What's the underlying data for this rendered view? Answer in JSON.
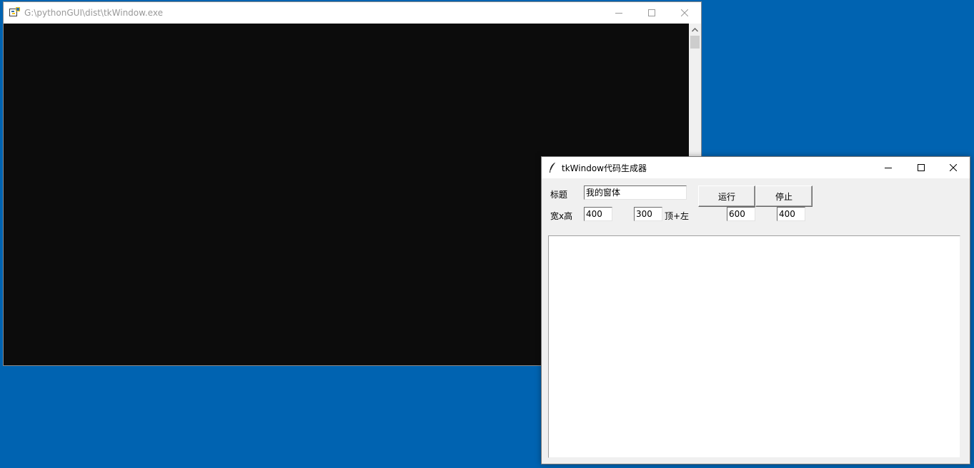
{
  "desktop": {
    "background": "#0063b1"
  },
  "console_window": {
    "title": "G:\\pythonGUI\\dist\\tkWindow.exe",
    "icon": "python-exe-icon",
    "background": "#0c0c0c"
  },
  "tk_window": {
    "title": "tkWindow代码生成器",
    "icon": "tk-feather-icon",
    "form": {
      "title_label": "标题",
      "title_value": "我的窗体",
      "size_label": "宽x高",
      "width_value": "400",
      "height_value": "300",
      "position_label": "顶+左",
      "top_value": "600",
      "left_value": "400"
    },
    "buttons": {
      "run_label": "运行",
      "stop_label": "停止"
    },
    "output_text": ""
  }
}
